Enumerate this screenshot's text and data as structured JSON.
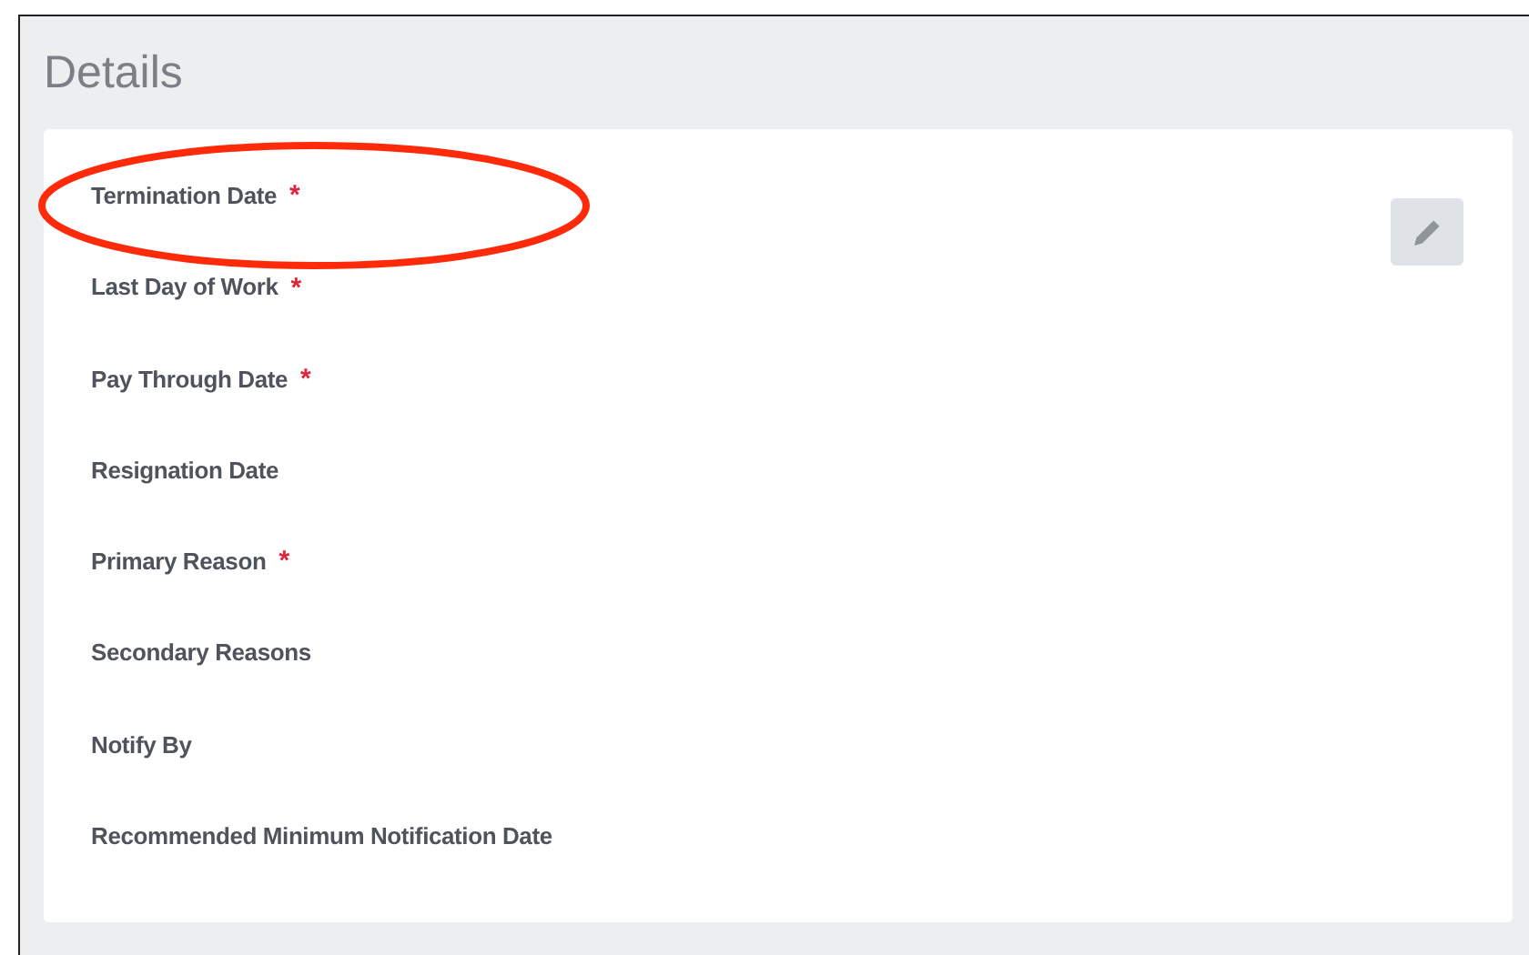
{
  "section": {
    "title": "Details"
  },
  "fields": [
    {
      "label": "Termination Date",
      "required_mark": "*",
      "highlighted": true
    },
    {
      "label": "Last Day of Work",
      "required_mark": "*"
    },
    {
      "label": "Pay Through Date",
      "required_mark": "*"
    },
    {
      "label": "Resignation Date"
    },
    {
      "label": "Primary Reason",
      "required_mark": "*"
    },
    {
      "label": "Secondary Reasons"
    },
    {
      "label": "Notify By"
    },
    {
      "label": "Recommended Minimum Notification Date"
    }
  ]
}
